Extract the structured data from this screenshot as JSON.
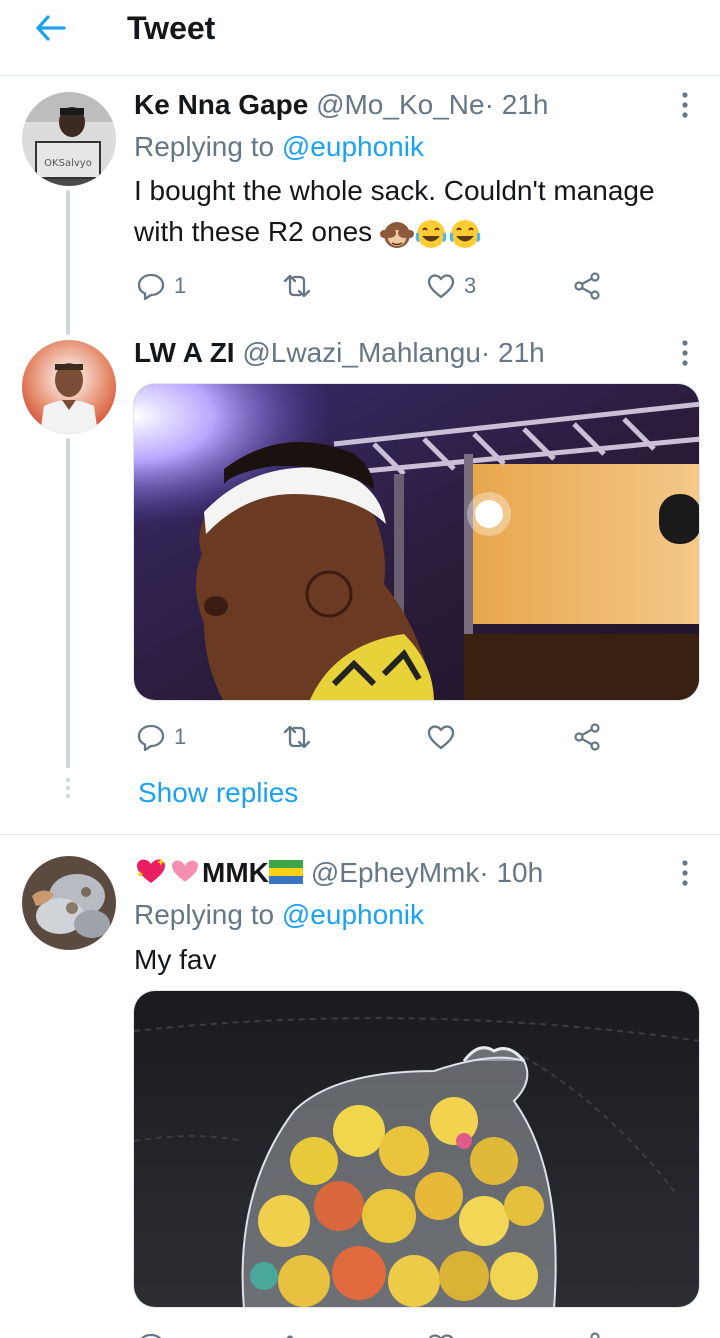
{
  "header": {
    "title": "Tweet"
  },
  "tweets": [
    {
      "name": "Ke Nna Gape",
      "handle": "@Mo_Ko_Ne",
      "sep": "·",
      "time": "21h",
      "replying_prefix": "Replying to ",
      "replying_to": "@euphonik",
      "text_line1": "I bought the whole sack. Couldn't manage",
      "text_line2": "with these R2 ones",
      "avatar_sign": "OKSalvyo",
      "reply_count": "1",
      "like_count": "3"
    },
    {
      "name": "LW A ZI",
      "handle": "@Lwazi_Mahlangu",
      "sep": "·",
      "time": "21h",
      "reply_count": "1",
      "show_replies": "Show replies"
    },
    {
      "name": "MMK",
      "handle": "@EpheyMmk",
      "sep": "·",
      "time": "10h",
      "replying_prefix": "Replying to ",
      "replying_to": "@euphonik",
      "text": "My fav"
    }
  ],
  "colors": {
    "accent": "#1da1f2",
    "secondary_text": "#657786",
    "primary_text": "#14171a",
    "border": "#e1e8ed",
    "thread_line": "#ccd6dd"
  },
  "icons": [
    "back-arrow-icon",
    "more-vertical-icon",
    "reply-icon",
    "retweet-icon",
    "like-icon",
    "share-icon"
  ]
}
